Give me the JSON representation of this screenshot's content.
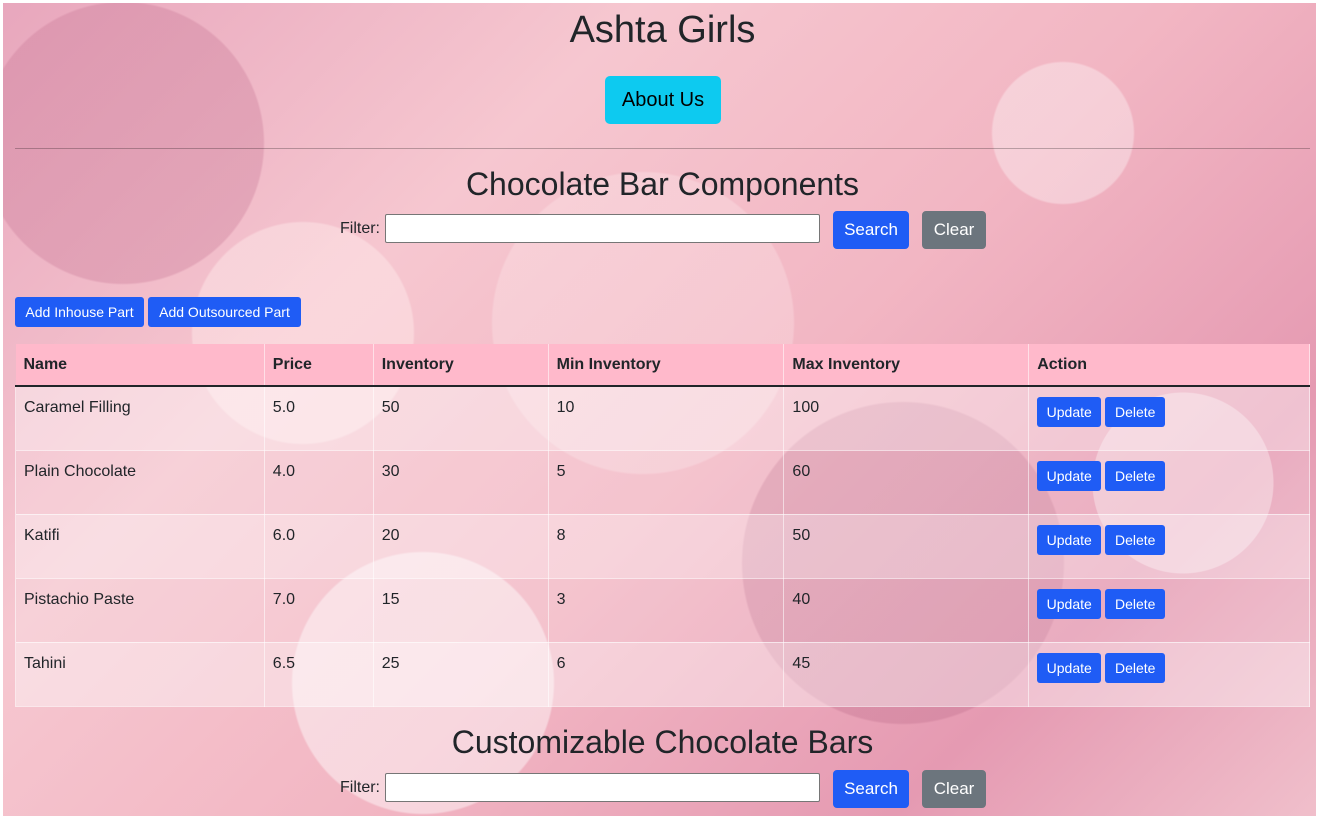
{
  "header": {
    "title": "Ashta Girls",
    "about_label": "About Us"
  },
  "components": {
    "title": "Chocolate Bar Components",
    "filter_label": "Filter:",
    "filter_value": "",
    "search_label": "Search",
    "clear_label": "Clear",
    "add_inhouse_label": "Add Inhouse Part",
    "add_outsourced_label": "Add Outsourced Part",
    "columns": [
      "Name",
      "Price",
      "Inventory",
      "Min Inventory",
      "Max Inventory",
      "Action"
    ],
    "rows": [
      {
        "name": "Caramel Filling",
        "price": "5.0",
        "inventory": "50",
        "min": "10",
        "max": "100"
      },
      {
        "name": "Plain Chocolate",
        "price": "4.0",
        "inventory": "30",
        "min": "5",
        "max": "60"
      },
      {
        "name": "Katifi",
        "price": "6.0",
        "inventory": "20",
        "min": "8",
        "max": "50"
      },
      {
        "name": "Pistachio Paste",
        "price": "7.0",
        "inventory": "15",
        "min": "3",
        "max": "40"
      },
      {
        "name": "Tahini",
        "price": "6.5",
        "inventory": "25",
        "min": "6",
        "max": "45"
      }
    ],
    "update_label": "Update",
    "delete_label": "Delete"
  },
  "products": {
    "title": "Customizable Chocolate Bars",
    "filter_label": "Filter:",
    "filter_value": "",
    "search_label": "Search",
    "clear_label": "Clear"
  },
  "colors": {
    "primary": "#1f5cf5",
    "info": "#0dcaf0",
    "secondary": "#6c757d",
    "table_header": "#ffb9cb"
  }
}
